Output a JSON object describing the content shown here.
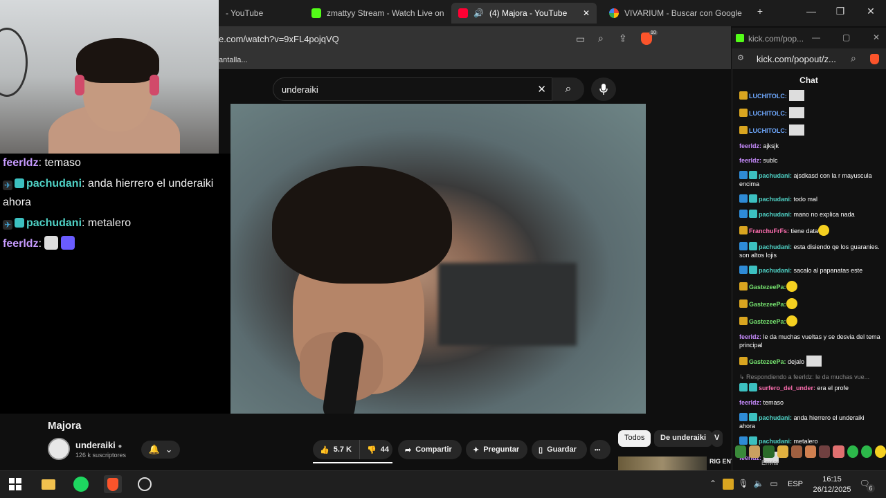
{
  "tabs": [
    {
      "label": "- YouTube"
    },
    {
      "label": "zmattyy Stream - Watch Live on K"
    },
    {
      "label": "(4) Majora - YouTube"
    },
    {
      "label": "VIVARIUM - Buscar con Google"
    }
  ],
  "window": {
    "new_tab": "+",
    "minimize": "—",
    "maximize": "❐",
    "close": "✕"
  },
  "address": {
    "url": "e.com/watch?v=9xFL4pojqVQ",
    "brave_count": "10"
  },
  "bookmarks": {
    "label": "antalla..."
  },
  "search": {
    "value": "underaiki"
  },
  "left_chat": [
    {
      "user": "feerldz",
      "text": "temaso",
      "color": "purple"
    },
    {
      "user": "pachudani",
      "text": "anda hierrero el underaiki ahora",
      "color": "teal"
    },
    {
      "user": "pachudani",
      "text": "metalero",
      "color": "teal"
    },
    {
      "user": "feerldz",
      "text": "",
      "color": "purple"
    }
  ],
  "video_info": {
    "title": "Majora",
    "channel": "underaiki",
    "subs": "126 k suscriptores",
    "likes": "5.7 K",
    "dislikes": "44",
    "share": "Compartir",
    "ask": "Preguntar",
    "save": "Guardar",
    "more": "•••"
  },
  "chips": [
    "Todos",
    "De underaiki",
    "V"
  ],
  "related": {
    "title": "RIG ENT"
  },
  "kick": {
    "window_title": "kick.com/pop...",
    "url": "kick.com/popout/z...",
    "header": "Chat",
    "messages": [
      {
        "badge": "yel",
        "user": "LUCHITOLC:",
        "color": "blue",
        "text": "",
        "img": true
      },
      {
        "badge": "yel",
        "user": "LUCHITOLC:",
        "color": "blue",
        "text": "",
        "img": true
      },
      {
        "badge": "yel",
        "user": "LUCHITOLC:",
        "color": "blue",
        "text": "",
        "img": true
      },
      {
        "badge": "",
        "user": "feerldz:",
        "color": "purple",
        "text": " ajksjk"
      },
      {
        "badge": "",
        "user": "feerldz:",
        "color": "purple",
        "text": " sublc"
      },
      {
        "badge": "blue",
        "user": "pachudani:",
        "color": "teal",
        "text": " ajsdkasd con la r mayuscula encima"
      },
      {
        "badge": "blue",
        "user": "pachudani:",
        "color": "teal",
        "text": " todo mal"
      },
      {
        "badge": "blue",
        "user": "pachudani:",
        "color": "teal",
        "text": " mano no explica nada"
      },
      {
        "badge": "yel",
        "user": "FranchuFrFs:",
        "color": "pink",
        "text": " tiene data",
        "emo": true
      },
      {
        "badge": "blue",
        "user": "pachudani:",
        "color": "teal",
        "text": " esta disiendo qe los guaranies. son altos lojis"
      },
      {
        "badge": "blue",
        "user": "pachudani:",
        "color": "teal",
        "text": " sacalo al papanatas este"
      },
      {
        "badge": "yel",
        "user": "GastezeePa:",
        "color": "green",
        "text": "",
        "emo": true
      },
      {
        "badge": "yel",
        "user": "GastezeePa:",
        "color": "green",
        "text": "",
        "emo": true
      },
      {
        "badge": "yel",
        "user": "GastezeePa:",
        "color": "green",
        "text": "",
        "emo": true
      },
      {
        "badge": "",
        "user": "feerldz:",
        "color": "purple",
        "text": " le da muchas vueltas y se desvia del tema principal"
      },
      {
        "badge": "yel",
        "user": "GastezeePa:",
        "color": "green",
        "text": " dejalo",
        "img": true
      },
      {
        "badge": "reply",
        "user": "",
        "color": "",
        "text": "↳ Respondiendo a feerldz: le da muchas vue..."
      },
      {
        "badge": "teal",
        "user": "surfero_del_under:",
        "color": "pink",
        "text": " era el profe"
      },
      {
        "badge": "",
        "user": "feerldz:",
        "color": "purple",
        "text": " temaso"
      },
      {
        "badge": "blue",
        "user": "pachudani:",
        "color": "teal",
        "text": " anda hierrero el underaiki ahora"
      },
      {
        "badge": "blue",
        "user": "pachudani:",
        "color": "teal",
        "text": " metalero"
      },
      {
        "badge": "",
        "user": "feerldz:",
        "color": "purple",
        "text": "",
        "img": true
      }
    ],
    "send": "Enviar"
  },
  "taskbar": {
    "lang": "ESP",
    "time": "16:15",
    "date": "26/12/2025",
    "notif": "6"
  },
  "colors": {
    "kick_green": "#53fc18",
    "yt_red": "#ff0033",
    "brave_orange": "#fb542b"
  }
}
